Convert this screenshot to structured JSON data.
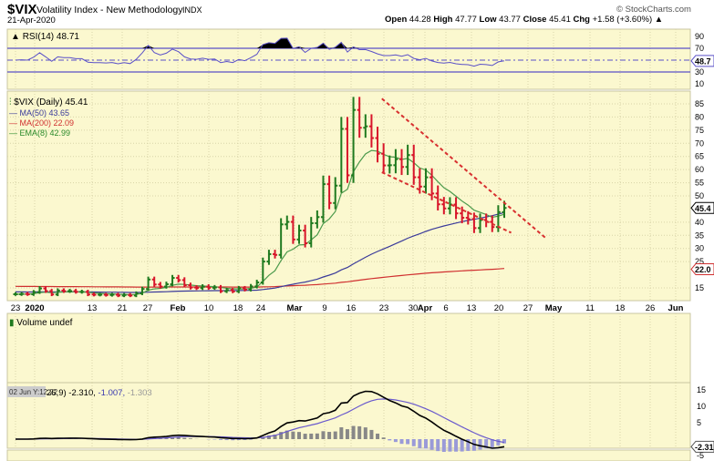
{
  "header": {
    "symbol": "$VIX",
    "name": "Volatility Index - New Methodology",
    "exchange": "INDX",
    "date": "21-Apr-2020",
    "brand": "© StockCharts.com",
    "open_label": "Open",
    "open": "44.28",
    "high_label": "High",
    "high": "47.77",
    "low_label": "Low",
    "low": "43.77",
    "close_label": "Close",
    "close": "45.41",
    "chg_label": "Chg",
    "chg": "+1.58 (+3.60%)"
  },
  "rsi": {
    "label": "RSI(14) 48.71",
    "ticks": [
      "90",
      "70",
      "30",
      "10"
    ],
    "badge": "48.7"
  },
  "price": {
    "label": "$VIX (Daily) 45.41",
    "ma50": "MA(50) 43.65",
    "ma200": "MA(200) 22.09",
    "ema8": "EMA(8) 42.99",
    "ticks": [
      "85",
      "80",
      "75",
      "70",
      "65",
      "60",
      "55",
      "50",
      "40",
      "35",
      "30",
      "25",
      "15"
    ],
    "badge_close": "45.4",
    "badge_ma200": "22.0"
  },
  "date_axis": [
    "23",
    "2020",
    "13",
    "21",
    "27",
    "Feb",
    "10",
    "18",
    "24",
    "Mar",
    "9",
    "16",
    "23",
    "30",
    "Apr",
    "6",
    "13",
    "20",
    "27",
    "May",
    "11",
    "18",
    "26",
    "Jun"
  ],
  "volume": {
    "label": "Volume undef"
  },
  "macd": {
    "tooltip": "02 Jun Y:12.22",
    "label_rest": "26,9)",
    "v1": "-2.310,",
    "v2": "-1.007,",
    "v3": "-1.303",
    "ticks": [
      "15",
      "10",
      "5",
      "-5"
    ],
    "badge": "-2.31"
  },
  "colors": {
    "bg": "#fbf8cf",
    "up": "#1f7a1f",
    "down": "#d8142a",
    "ma50": "#3a3a9a",
    "ma200": "#d03030",
    "ema8": "#4c9a4c",
    "rsi": "#5a50c8",
    "trend": "#d83030"
  },
  "chart_data": {
    "type": "ohlc",
    "title": "$VIX Volatility Index - New Methodology (Daily)",
    "xlabel": "",
    "ylabel": "",
    "ylim": [
      12,
      88
    ],
    "start": "2019-12-23",
    "end": "2020-04-21",
    "closes": [
      12.6,
      12.7,
      12.6,
      13.4,
      14.8,
      13.8,
      12.5,
      14.0,
      13.8,
      13.8,
      13.5,
      13.5,
      12.5,
      12.4,
      12.4,
      12.3,
      12.4,
      12.1,
      12.3,
      12.1,
      12.9,
      14.6,
      18.2,
      16.3,
      15.5,
      16.4,
      18.8,
      17.97,
      16.05,
      15.15,
      14.96,
      15.47,
      15.04,
      15.18,
      13.74,
      14.15,
      13.68,
      14.83,
      14.38,
      15.56,
      17.08,
      25.03,
      27.85,
      27.56,
      39.16,
      40.11,
      33.42,
      36.82,
      31.99,
      39.62,
      41.94,
      54.46,
      47.3,
      53.9,
      75.47,
      57.83,
      82.69,
      75.91,
      76.45,
      72.0,
      66.04,
      61.59,
      61.67,
      63.95,
      61.0,
      65.54,
      57.08,
      53.54,
      57.06,
      50.91,
      46.8,
      45.24,
      46.7,
      43.35,
      41.67,
      41.17,
      37.76,
      40.84,
      40.11,
      38.15,
      43.83,
      45.41
    ],
    "indicators": [
      "RSI(14)",
      "MA(50)",
      "MA(200)",
      "EMA(8)",
      "MACD(12,26,9)"
    ],
    "trendlines": [
      {
        "from": [
          "2020-03-17",
          87
        ],
        "to": [
          "2020-04-24",
          34
        ]
      },
      {
        "from": [
          "2020-03-17",
          59
        ],
        "to": [
          "2020-04-16",
          36
        ]
      }
    ]
  }
}
